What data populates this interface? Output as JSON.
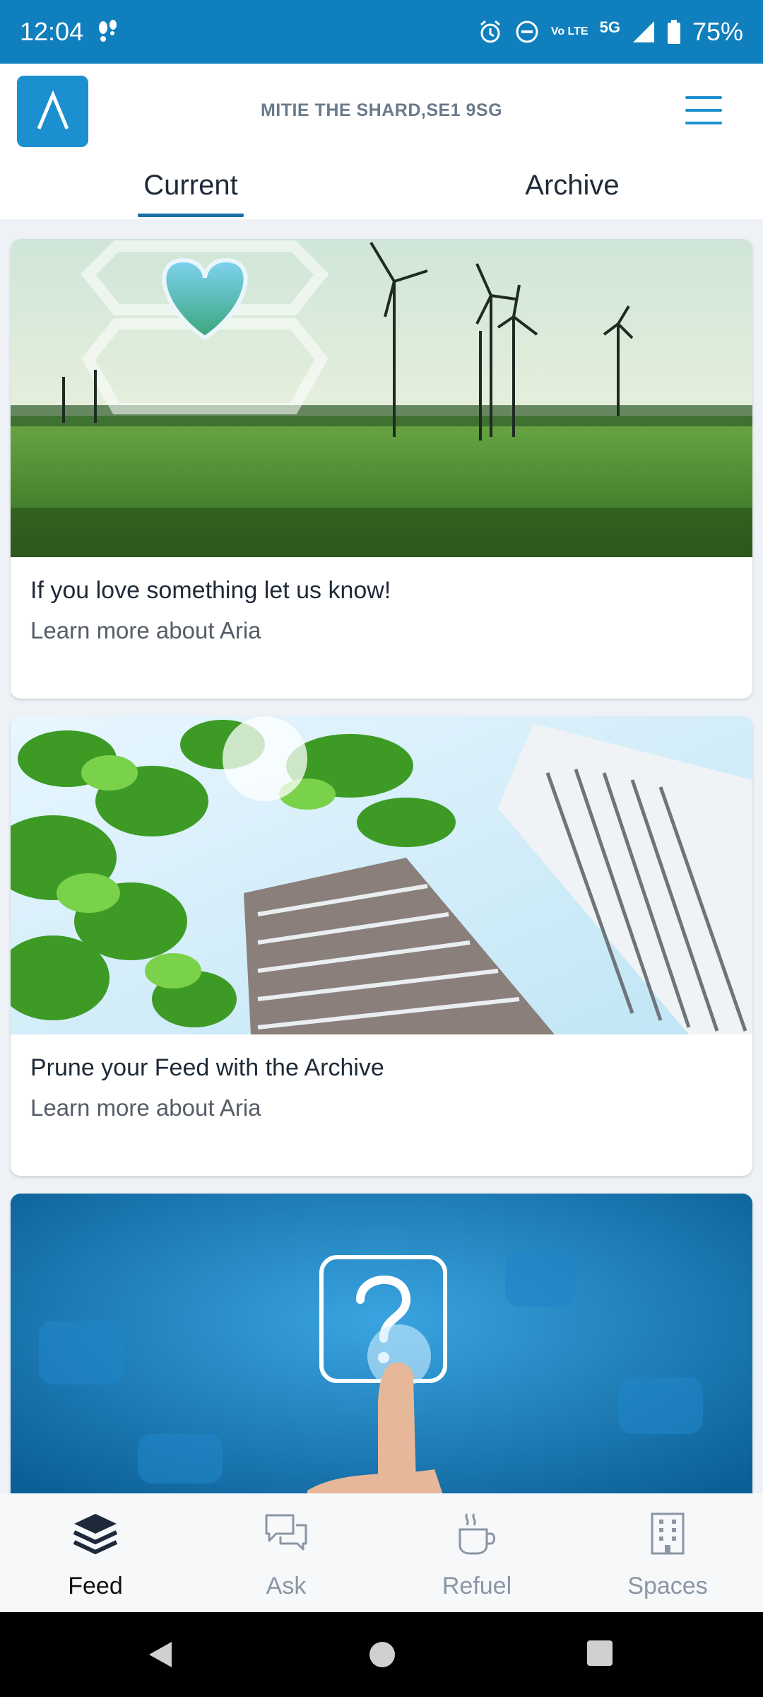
{
  "status_bar": {
    "time": "12:04",
    "battery": "75%",
    "network": "5G",
    "lte_label": "Vo LTE"
  },
  "header": {
    "site_name": "MITIE THE SHARD,SE1 9SG"
  },
  "tabs": [
    {
      "label": "Current",
      "active": true
    },
    {
      "label": "Archive",
      "active": false
    }
  ],
  "feed": [
    {
      "title": "If you love something let us know!",
      "subtitle": "Learn more about Aria"
    },
    {
      "title": "Prune your Feed with the Archive",
      "subtitle": "Learn more about Aria"
    },
    {
      "title": "",
      "subtitle": ""
    }
  ],
  "bottom_nav": [
    {
      "label": "Feed",
      "icon": "layers-icon",
      "active": true
    },
    {
      "label": "Ask",
      "icon": "chat-bubbles-icon",
      "active": false
    },
    {
      "label": "Refuel",
      "icon": "coffee-cup-icon",
      "active": false
    },
    {
      "label": "Spaces",
      "icon": "building-icon",
      "active": false
    }
  ],
  "colors": {
    "brand_blue": "#0f7fbd",
    "accent_blue": "#1b8fcf",
    "active_tab": "#1b6fa8"
  }
}
